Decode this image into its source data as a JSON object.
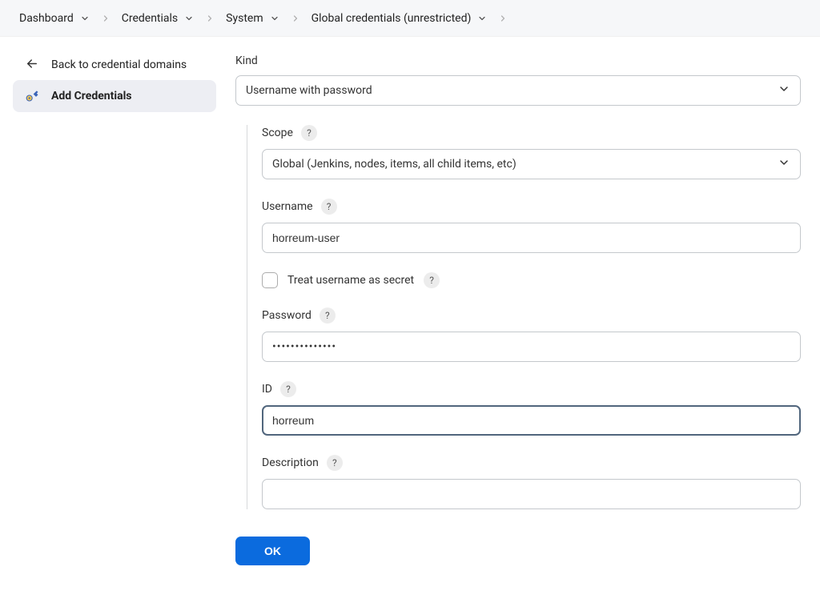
{
  "breadcrumb": {
    "items": [
      {
        "label": "Dashboard"
      },
      {
        "label": "Credentials"
      },
      {
        "label": "System"
      },
      {
        "label": "Global credentials (unrestricted)"
      }
    ]
  },
  "sidebar": {
    "back_label": "Back to credential domains",
    "add_label": "Add Credentials"
  },
  "form": {
    "kind_label": "Kind",
    "kind_value": "Username with password",
    "scope_label": "Scope",
    "scope_value": "Global (Jenkins, nodes, items, all child items, etc)",
    "username_label": "Username",
    "username_value": "horreum-user",
    "treat_secret_label": "Treat username as secret",
    "password_label": "Password",
    "password_value": "••••••••••••••",
    "id_label": "ID",
    "id_value": "horreum",
    "description_label": "Description",
    "description_value": ""
  },
  "buttons": {
    "ok": "OK"
  },
  "icons": {
    "help": "?"
  }
}
